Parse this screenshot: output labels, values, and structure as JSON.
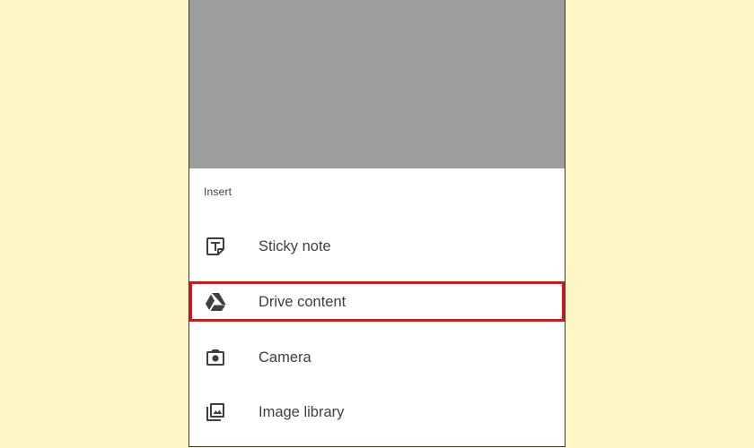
{
  "sheet": {
    "title": "Insert",
    "items": [
      {
        "label": "Sticky note",
        "icon": "sticky-note-icon"
      },
      {
        "label": "Drive content",
        "icon": "google-drive-icon"
      },
      {
        "label": "Camera",
        "icon": "camera-icon"
      },
      {
        "label": "Image library",
        "icon": "image-library-icon"
      }
    ]
  },
  "colors": {
    "page_background": "#fff6c6",
    "backdrop": "#9e9e9e",
    "text": "#3c4043",
    "highlight": "#e11212"
  }
}
